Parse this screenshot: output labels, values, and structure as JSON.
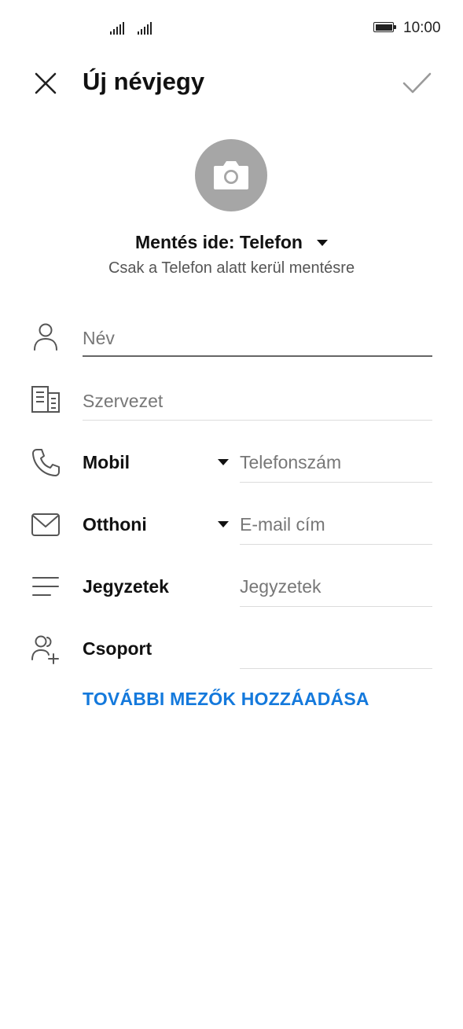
{
  "status_bar": {
    "time": "10:00"
  },
  "header": {
    "title": "Új névjegy"
  },
  "save_location": {
    "label": "Mentés ide: Telefon",
    "hint": "Csak a Telefon alatt kerül mentésre"
  },
  "form": {
    "name_placeholder": "Név",
    "organization_placeholder": "Szervezet",
    "phone": {
      "label": "Mobil",
      "placeholder": "Telefonszám"
    },
    "email": {
      "label": "Otthoni",
      "placeholder": "E-mail cím"
    },
    "notes": {
      "label": "Jegyzetek",
      "placeholder": "Jegyzetek"
    },
    "group": {
      "label": "Csoport"
    }
  },
  "add_fields_label": "TOVÁBBI MEZŐK HOZZÁADÁSA",
  "colors": {
    "accent": "#1479dc",
    "avatar_bg": "#a6a6a6"
  },
  "icons": [
    "signal-icon",
    "battery-icon",
    "close-icon",
    "check-icon",
    "camera-icon",
    "person-icon",
    "organization-icon",
    "phone-icon",
    "email-icon",
    "notes-icon",
    "group-icon"
  ]
}
